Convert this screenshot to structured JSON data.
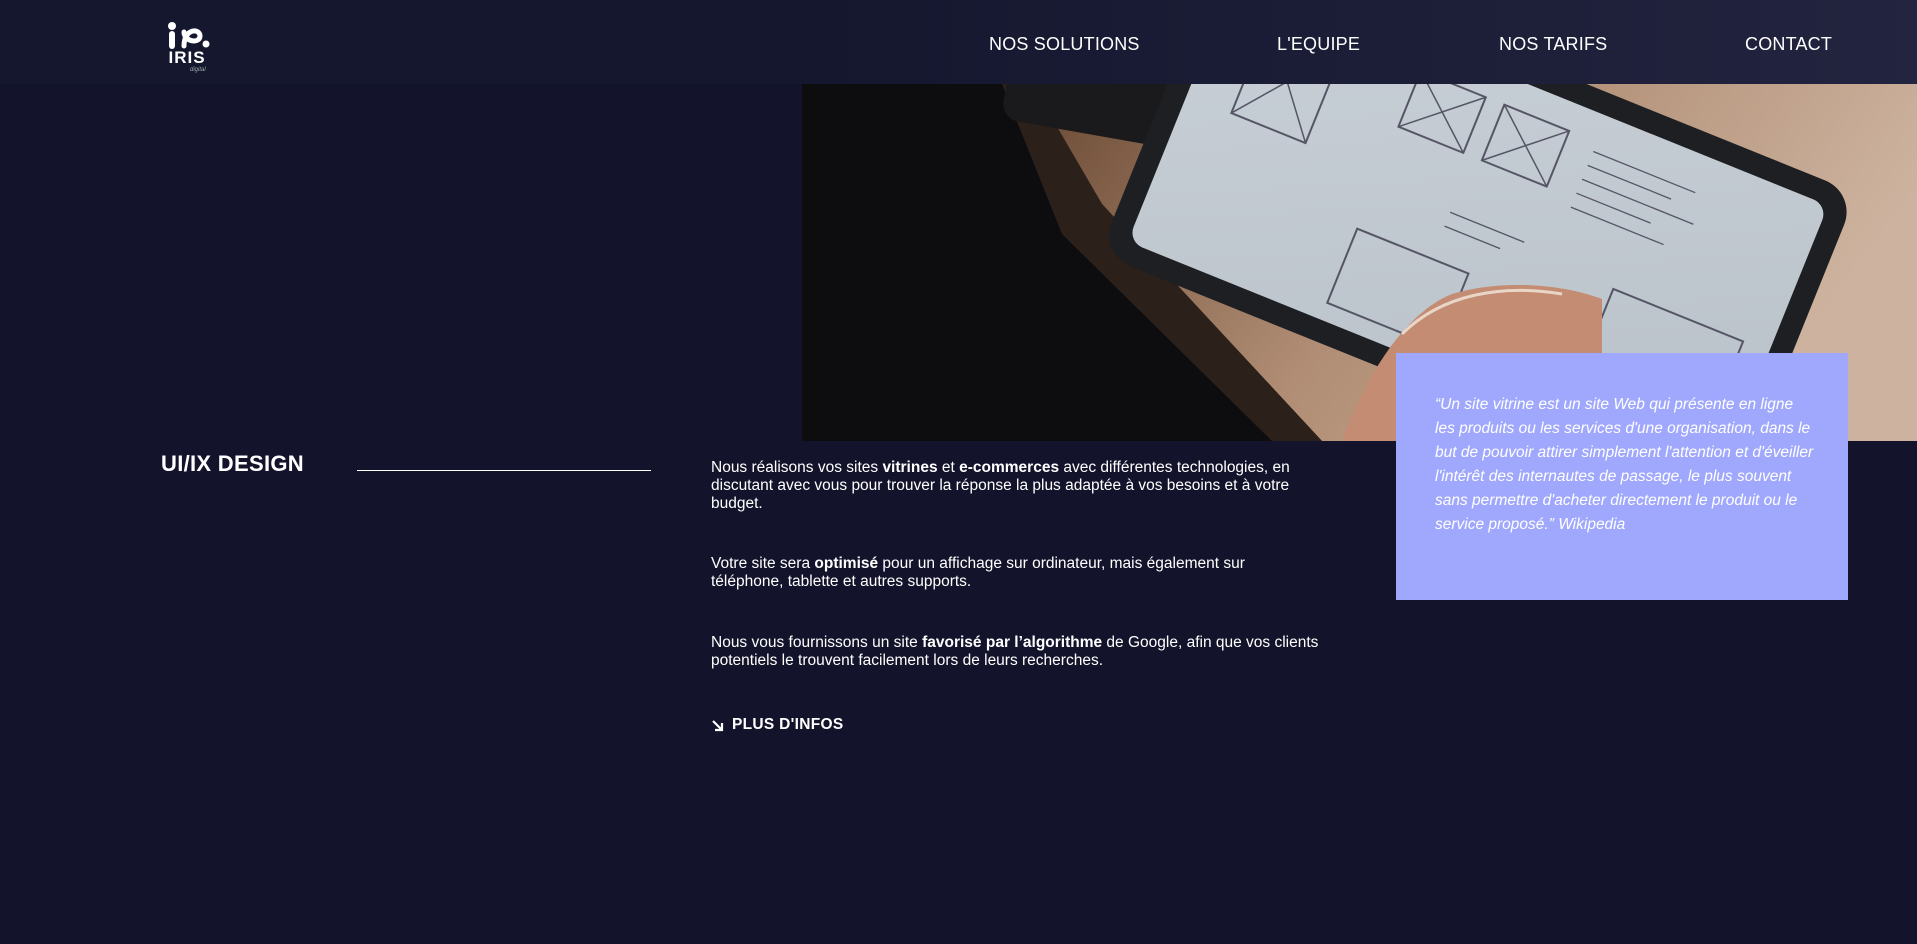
{
  "brand": {
    "name": "IRIS",
    "tagline": "digital"
  },
  "nav": {
    "items": [
      {
        "label": "NOS SOLUTIONS"
      },
      {
        "label": "L'EQUIPE"
      },
      {
        "label": "NOS TARIFS"
      },
      {
        "label": "CONTACT"
      }
    ]
  },
  "hero": {
    "image_icon": "tablet-wireframe-photo"
  },
  "section": {
    "title": "UI/IX DESIGN",
    "paragraphs": [
      [
        {
          "text": "Nous réalisons vos sites ",
          "bold": false
        },
        {
          "text": "vitrines",
          "bold": true
        },
        {
          "text": " et ",
          "bold": false
        },
        {
          "text": "e-commerces",
          "bold": true
        },
        {
          "text": " avec différentes technologies, en discutant avec vous pour trouver la réponse la plus adaptée à vos besoins et à votre budget.",
          "bold": false
        }
      ],
      [
        {
          "text": "Votre site sera ",
          "bold": false
        },
        {
          "text": "optimisé",
          "bold": true
        },
        {
          "text": " pour un affichage sur ordinateur, mais également sur téléphone, tablette et autres supports.",
          "bold": false
        }
      ],
      [
        {
          "text": "Nous vous fournissons un site ",
          "bold": false
        },
        {
          "text": "favorisé par l’algorithme",
          "bold": true
        },
        {
          "text": " de Google, afin que vos clients potentiels le trouvent facilement lors de leurs recherches.",
          "bold": false
        }
      ]
    ],
    "more_label": "PLUS D'INFOS",
    "more_icon": "arrow-down-right-icon"
  },
  "quote": {
    "text": "“Un site vitrine est un site Web qui présente en ligne les produits ou les services d'une organisation, dans le but de pouvoir attirer simplement l'attention et d'éveiller l'intérêt des internautes de passage, le plus souvent sans permettre d'acheter directement le produit ou le service proposé.” Wikipedia"
  },
  "colors": {
    "background": "#13142b",
    "quote_box": "#a0a8fd",
    "text": "#ffffff"
  }
}
